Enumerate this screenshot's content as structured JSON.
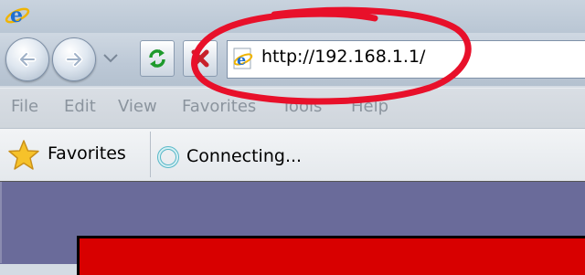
{
  "browser": {
    "address": {
      "url": "http://192.168.1.1/"
    },
    "menu": [
      {
        "label": "File"
      },
      {
        "label": "Edit"
      },
      {
        "label": "View"
      },
      {
        "label": "Favorites"
      },
      {
        "label": "Tools"
      },
      {
        "label": "Help"
      }
    ],
    "favorites_bar": {
      "favorites_label": "Favorites",
      "tab_label": "Connecting..."
    }
  },
  "colors": {
    "highlight": "#e8102a",
    "content_bg": "#6a6b9a",
    "content_box": "#d80000"
  },
  "icons": [
    "ie-logo-icon",
    "back-arrow-icon",
    "forward-arrow-icon",
    "chevron-down-icon",
    "refresh-icon",
    "stop-icon",
    "page-ie-icon",
    "star-icon",
    "loading-spinner-icon"
  ]
}
